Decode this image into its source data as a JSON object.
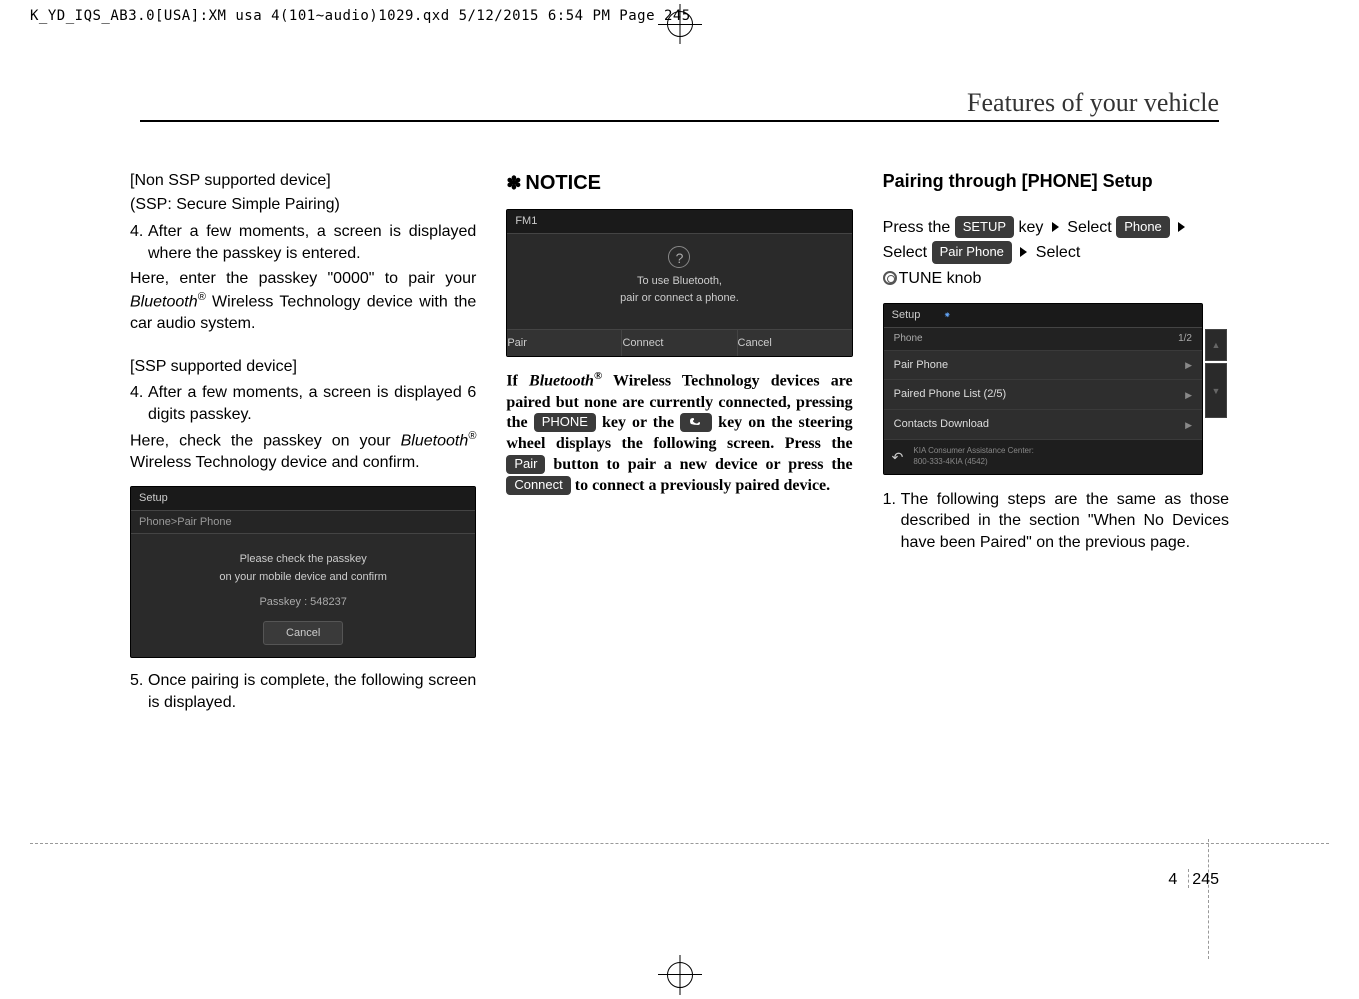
{
  "file_header": "K_YD_IQS_AB3.0[USA]:XM usa 4(101~audio)1029.qxd  5/12/2015  6:54 PM  Page 245",
  "page_title": "Features of your vehicle",
  "col1": {
    "h1": "[Non SSP supported device]",
    "h1b": "(SSP: Secure Simple Pairing)",
    "s1_num": "4.",
    "s1": "After a few moments, a screen is displayed where the passkey is entered.",
    "p1a": "Here, enter the passkey \"0000\" to pair your ",
    "p1b": " Wireless Technology device with the car audio system.",
    "bt": "Bluetooth",
    "h2": "[SSP supported device]",
    "s2_num": "4.",
    "s2": "After a few moments, a screen is displayed 6 digits passkey.",
    "p2a": "Here, check the passkey on your ",
    "p2b": " Wireless Technology device and confirm.",
    "s3_num": "5.",
    "s3": "Once pairing is complete, the following screen is displayed.",
    "shot": {
      "title": "Setup",
      "crumb": "Phone>Pair Phone",
      "line1": "Please check the passkey",
      "line2": "on your mobile device and confirm",
      "passkey": "Passkey : 548237",
      "cancel": "Cancel"
    }
  },
  "col2": {
    "notice": "NOTICE",
    "shot": {
      "title": "FM1",
      "line1": "To use Bluetooth,",
      "line2": "pair or connect a phone.",
      "pair": "Pair",
      "connect": "Connect",
      "cancel": "Cancel"
    },
    "n1": "If ",
    "n1bt": "Bluetooth",
    "n2": " Wireless Technology devices are paired but none are currently connected, pressing the ",
    "phone_btn": "PHONE",
    "n3": " key or the ",
    "n4": " key on the steering wheel displays the following screen. Press the ",
    "pair_btn": "Pair",
    "n5": " button to pair a new device or press the ",
    "connect_btn": "Connect",
    "n6": " to connect a previously paired device."
  },
  "col3": {
    "head": "Pairing through [PHONE] Setup",
    "press": "Press the ",
    "setup_btn": "SETUP",
    "key": " key ",
    "select": " Select ",
    "phone_btn": "Phone",
    "pairphone_btn": "Pair Phone",
    "tune": "TUNE knob",
    "shot": {
      "title": "Setup",
      "head": "Phone",
      "page": "1/2",
      "item1": "Pair Phone",
      "item2": "Paired Phone List (2/5)",
      "item3": "Contacts Download",
      "footer1": "KIA Consumer Assistance Center:",
      "footer2": "800-333-4KIA (4542)"
    },
    "s1_num": "1.",
    "s1": "The following steps are the same as those described in the section \"When No Devices have been Paired\" on the previous page."
  },
  "page_num": {
    "section": "4",
    "page": "245"
  }
}
